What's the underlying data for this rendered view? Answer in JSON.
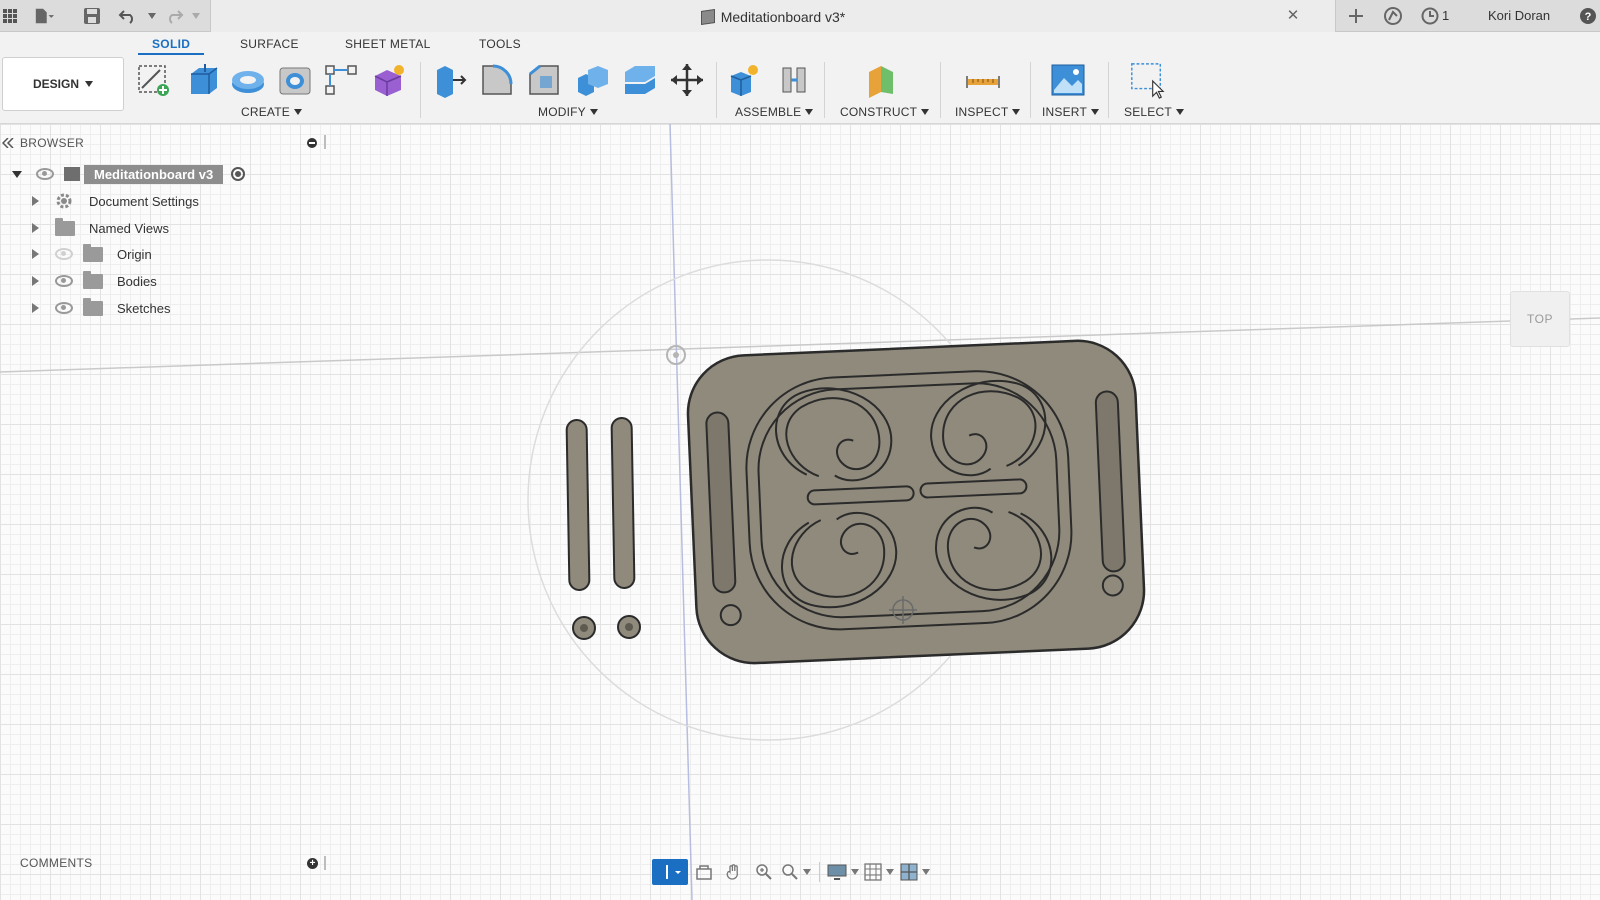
{
  "window": {
    "doc_title": "Meditationboard v3*",
    "user_name": "Kori Doran",
    "job_count": "1"
  },
  "toolbar": {
    "workspace_tabs": [
      "SOLID",
      "SURFACE",
      "SHEET METAL",
      "TOOLS"
    ],
    "active_tab": "SOLID",
    "design_label": "DESIGN",
    "groups": [
      "CREATE",
      "MODIFY",
      "ASSEMBLE",
      "CONSTRUCT",
      "INSPECT",
      "INSERT",
      "SELECT"
    ]
  },
  "browser": {
    "header": "BROWSER",
    "root": "Meditationboard v3",
    "items": [
      {
        "label": "Document Settings",
        "icon": "gear-icon"
      },
      {
        "label": "Named Views",
        "icon": "folder-icon"
      },
      {
        "label": "Origin",
        "icon": "folder-icon"
      },
      {
        "label": "Bodies",
        "icon": "folder-icon"
      },
      {
        "label": "Sketches",
        "icon": "folder-icon"
      }
    ]
  },
  "comments": {
    "header": "COMMENTS"
  },
  "viewcube": {
    "face": "TOP"
  },
  "colors": {
    "accent": "#1a6fc2",
    "body_fill": "#8f8a7c",
    "body_stroke": "#2b2b2b"
  }
}
